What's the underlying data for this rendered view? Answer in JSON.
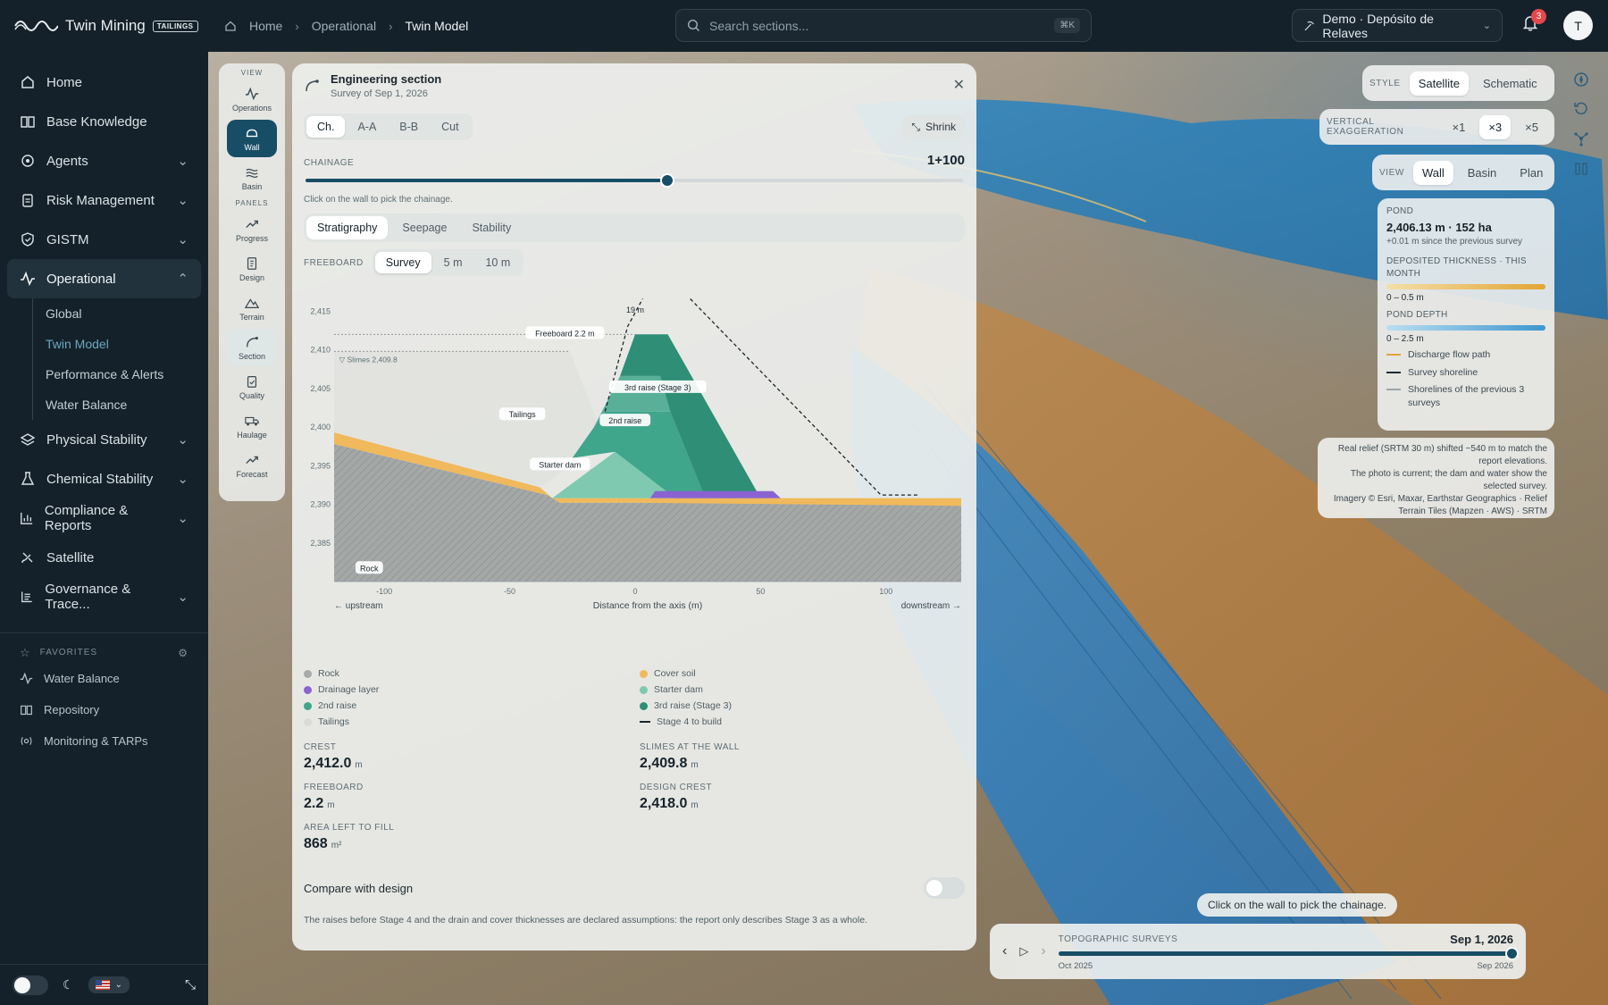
{
  "brand": {
    "name": "Twin Mining",
    "tag": "TAILINGS"
  },
  "breadcrumb": [
    "Home",
    "Operational",
    "Twin Model"
  ],
  "search": {
    "placeholder": "Search sections...",
    "shortcut": "⌘K"
  },
  "workspace": {
    "label": "Demo · Depósito de Relaves"
  },
  "notifications": {
    "count": "3"
  },
  "user": {
    "initial": "T"
  },
  "sidebar": {
    "items": [
      {
        "label": "Home",
        "icon": "home-icon"
      },
      {
        "label": "Base Knowledge",
        "icon": "book-icon"
      },
      {
        "label": "Agents",
        "icon": "agent-icon"
      },
      {
        "label": "Risk Management",
        "icon": "clipboard-icon"
      },
      {
        "label": "GISTM",
        "icon": "shield-icon"
      },
      {
        "label": "Operational",
        "icon": "activity-icon"
      },
      {
        "label": "Physical Stability",
        "icon": "layers-icon"
      },
      {
        "label": "Chemical Stability",
        "icon": "flask-icon"
      },
      {
        "label": "Compliance & Reports",
        "icon": "bar-chart-icon"
      },
      {
        "label": "Satellite",
        "icon": "satellite-icon"
      },
      {
        "label": "Governance & Trace...",
        "icon": "ledger-icon"
      }
    ],
    "operational_sub": [
      "Global",
      "Twin Model",
      "Performance & Alerts",
      "Water Balance"
    ],
    "favorites_title": "FAVORITES",
    "favorites": [
      "Water Balance",
      "Repository",
      "Monitoring & TARPs"
    ]
  },
  "rail": {
    "view_title": "VIEW",
    "view_buttons": [
      "Operations",
      "Wall",
      "Basin"
    ],
    "panels_title": "PANELS",
    "panel_buttons": [
      "Progress",
      "Design",
      "Terrain",
      "Section",
      "Quality",
      "Haulage",
      "Forecast"
    ]
  },
  "section": {
    "title": "Engineering section",
    "subtitle": "Survey of Sep 1, 2026",
    "section_tabs": [
      "Ch.",
      "A-A",
      "B-B",
      "Cut"
    ],
    "shrink": "Shrink",
    "chainage_label": "CHAINAGE",
    "chainage_value": "1+100",
    "chainage_fraction": 0.55,
    "chainage_hint": "Click on the wall to pick the chainage.",
    "analysis_tabs": [
      "Stratigraphy",
      "Seepage",
      "Stability"
    ],
    "freeboard_label": "FREEBOARD",
    "freeboard_options": [
      "Survey",
      "5 m",
      "10 m"
    ],
    "legend_left": [
      "Rock",
      "Drainage layer",
      "2nd raise",
      "Tailings"
    ],
    "legend_right": [
      "Cover soil",
      "Starter dam",
      "3rd raise (Stage 3)",
      "Stage 4 to build"
    ],
    "stats": [
      {
        "label": "CREST",
        "value": "2,412.0",
        "unit": "m"
      },
      {
        "label": "SLIMES AT THE WALL",
        "value": "2,409.8",
        "unit": "m"
      },
      {
        "label": "FREEBOARD",
        "value": "2.2",
        "unit": "m"
      },
      {
        "label": "DESIGN CREST",
        "value": "2,418.0",
        "unit": "m"
      },
      {
        "label": "AREA LEFT TO FILL",
        "value": "868",
        "unit": "m²"
      }
    ],
    "compare_label": "Compare with design",
    "note": "The raises before Stage 4 and the drain and cover thicknesses are declared assumptions: the report only describes Stage 3 as a whole."
  },
  "chart_data": {
    "type": "area",
    "xlabel": "Distance from the axis (m)",
    "x_ticks": [
      "-100",
      "-50",
      "0",
      "50",
      "100"
    ],
    "y_ticks": [
      "2,415",
      "2,410",
      "2,405",
      "2,400",
      "2,395",
      "2,390",
      "2,385"
    ],
    "xlim": [
      -120,
      130
    ],
    "ylim": [
      2380,
      2417
    ],
    "upstream_label": "← upstream",
    "downstream_label": "downstream →",
    "annotations": {
      "freeboard": "Freeboard 2.2 m",
      "width": "19 m",
      "slimes": "▽ Slimes 2,409.8",
      "third_raise": "3rd raise (Stage 3)",
      "second_raise": "2nd raise",
      "tailings": "Tailings",
      "starter": "Starter dam",
      "rock": "Rock"
    },
    "layer_colors": {
      "rock": "#9fa3a2",
      "cover": "#f0b95b",
      "drain": "#8a63d2",
      "starter": "#7ec9b0",
      "raise2": "#3fa58b",
      "raise3": "#2e8e76",
      "tailings": "#dcdedb"
    }
  },
  "map_controls": {
    "style_label": "STYLE",
    "style_options": [
      "Satellite",
      "Schematic"
    ],
    "vexag_label": "VERTICAL EXAGGERATION",
    "vexag_options": [
      "×1",
      "×3",
      "×5"
    ],
    "view_label": "VIEW",
    "view_options": [
      "Wall",
      "Basin",
      "Plan"
    ]
  },
  "map_legend": {
    "pond_label": "POND",
    "pond_value": "2,406.13 m · 152 ha",
    "pond_delta": "+0.01 m since the previous survey",
    "thickness_label": "DEPOSITED THICKNESS · THIS MONTH",
    "thickness_range": "0 – 0.5 m",
    "depth_label": "POND DEPTH",
    "depth_range": "0 – 2.5 m",
    "lines": [
      "Discharge flow path",
      "Survey shoreline",
      "Shorelines of the previous 3 surveys"
    ]
  },
  "credits": [
    "Real relief (SRTM 30 m) shifted −540 m to match the report elevations.",
    "The photo is current; the dam and water show the selected survey.",
    "Imagery © Esri, Maxar, Earthstar Geographics · Relief Terrain Tiles (Mapzen · AWS) · SRTM"
  ],
  "map_tip": "Click on the wall to pick the chainage.",
  "timeline": {
    "label": "TOPOGRAPHIC SURVEYS",
    "current": "Sep 1, 2026",
    "start": "Oct 2025",
    "end": "Sep 2026"
  }
}
